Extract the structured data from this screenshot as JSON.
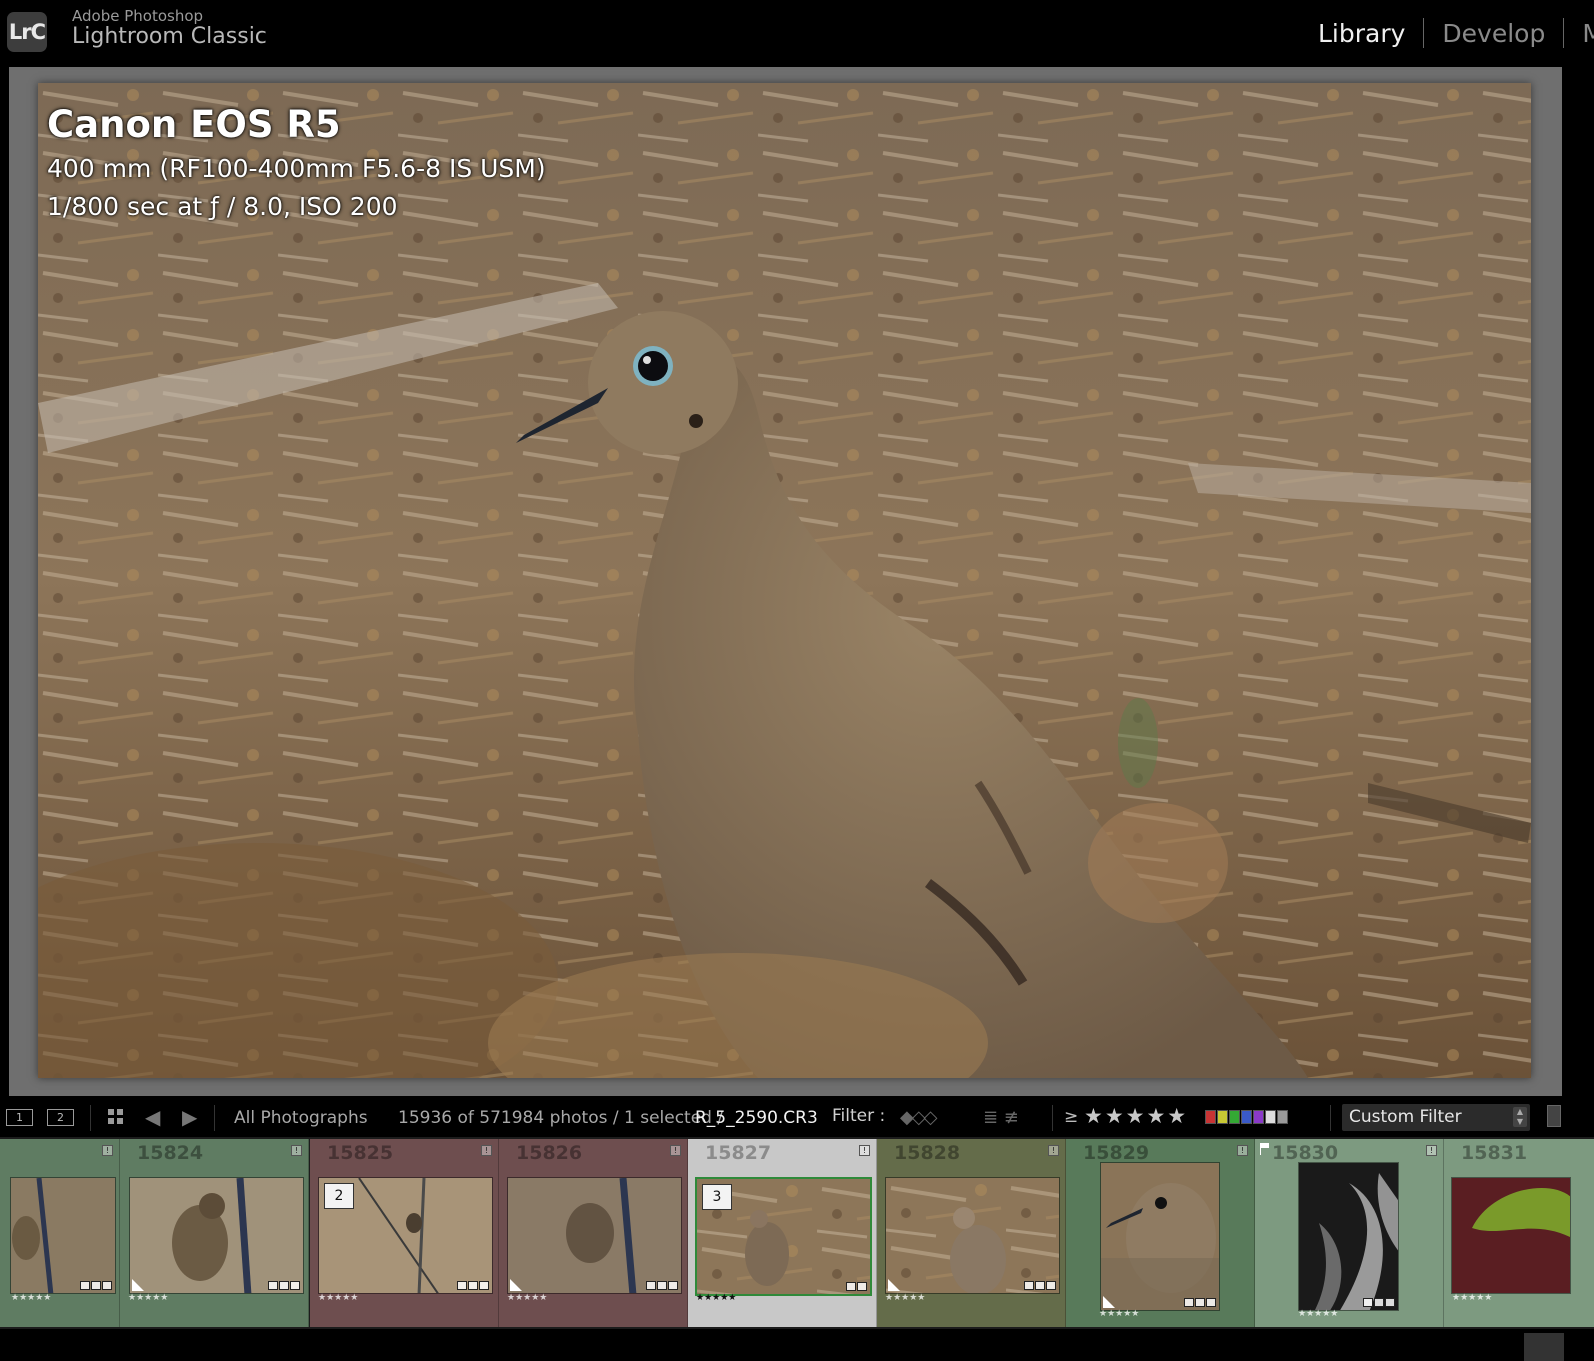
{
  "app": {
    "logo_text": "LrC",
    "brand_top": "Adobe Photoshop",
    "brand_main": "Lightroom Classic",
    "modules": [
      {
        "label": "Library",
        "active": true
      },
      {
        "label": "Develop",
        "active": false
      },
      {
        "label": "M",
        "active": false
      }
    ]
  },
  "loupe": {
    "camera": "Canon EOS R5",
    "lens": "400 mm (RF100-400mm F5.6-8 IS USM)",
    "exposure": "1/800 sec at ƒ / 8.0, ISO 200"
  },
  "toolbar": {
    "screen_1": "1",
    "screen_2": "2",
    "prev_icon": "arrow-left-icon",
    "next_icon": "arrow-right-icon",
    "source": "All Photographs",
    "count": "15936 of 571984 photos / 1 selected /",
    "filename": "R_5_2590.CR3",
    "filter_label": "Filter :",
    "rating_op": "≥",
    "rating_stars": "★★★★★",
    "color_labels": [
      "#c83434",
      "#c8c834",
      "#34a834",
      "#3a5ac8",
      "#8a3ac8",
      "#dddddd",
      "#999999"
    ],
    "custom_filter": "Custom Filter"
  },
  "filmstrip": {
    "cells": [
      {
        "num": "",
        "bg": "#5f7c62",
        "stars": "★★★★★"
      },
      {
        "num": "15824",
        "bg": "#5f7c62",
        "stars": "★★★★★"
      },
      {
        "num": "15825",
        "bg": "#6e4e4f",
        "stars": "★★★★★",
        "stack": "2"
      },
      {
        "num": "15826",
        "bg": "#6e4e4f",
        "stars": "★★★★★"
      },
      {
        "num": "15827",
        "bg": "#c8c8c8",
        "stars": "★★★★★",
        "stack": "3",
        "selected": true
      },
      {
        "num": "15828",
        "bg": "#646c4a",
        "stars": "★★★★★"
      },
      {
        "num": "15829",
        "bg": "#587a5a",
        "stars": "★★★★★"
      },
      {
        "num": "15830",
        "bg": "#7d9a80",
        "stars": "★★★★★",
        "flagged": true
      },
      {
        "num": "15831",
        "bg": "#7d9a80",
        "stars": "★★★★★"
      }
    ]
  }
}
